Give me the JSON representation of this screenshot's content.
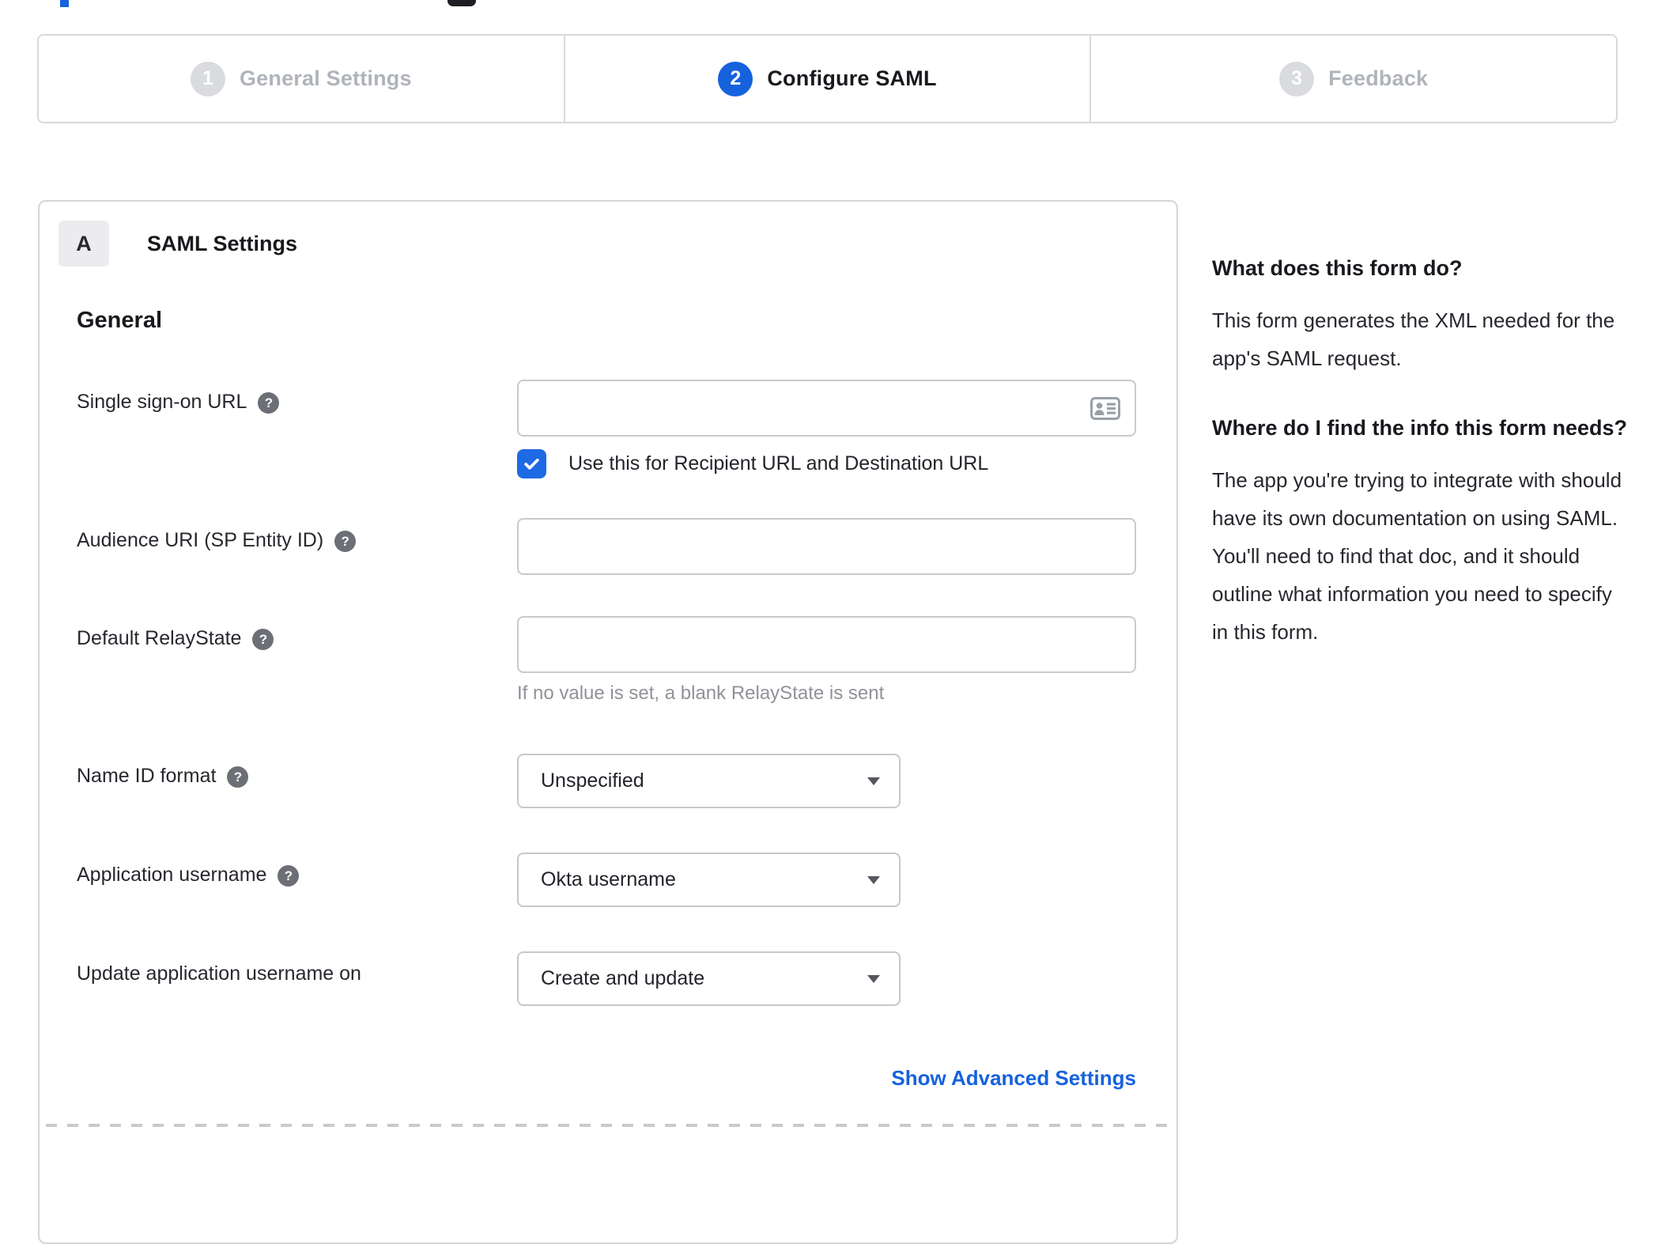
{
  "colors": {
    "accent": "#1662dd",
    "inactive_gray": "#b0b4ba"
  },
  "stepper": {
    "steps": [
      {
        "number": "1",
        "label": "General Settings",
        "active": false
      },
      {
        "number": "2",
        "label": "Configure SAML",
        "active": true
      },
      {
        "number": "3",
        "label": "Feedback",
        "active": false
      }
    ]
  },
  "panel": {
    "section_badge": "A",
    "section_title": "SAML Settings",
    "group_title": "General",
    "fields": {
      "sso": {
        "label": "Single sign-on URL",
        "value": "",
        "checkbox_label": "Use this for Recipient URL and Destination URL",
        "checkbox_checked": true
      },
      "audience": {
        "label": "Audience URI (SP Entity ID)",
        "value": ""
      },
      "relay": {
        "label": "Default RelayState",
        "value": "",
        "helper": "If no value is set, a blank RelayState is sent"
      },
      "nameid": {
        "label": "Name ID format",
        "value": "Unspecified"
      },
      "appuser": {
        "label": "Application username",
        "value": "Okta username"
      },
      "updateuser": {
        "label": "Update application username on",
        "value": "Create and update"
      }
    },
    "advanced_link": "Show Advanced Settings"
  },
  "sidebar": {
    "q1": "What does this form do?",
    "a1": "This form generates the XML needed for the app's SAML request.",
    "q2": "Where do I find the info this form needs?",
    "a2": "The app you're trying to integrate with should have its own documentation on using SAML. You'll need to find that doc, and it should outline what information you need to specify in this form."
  }
}
